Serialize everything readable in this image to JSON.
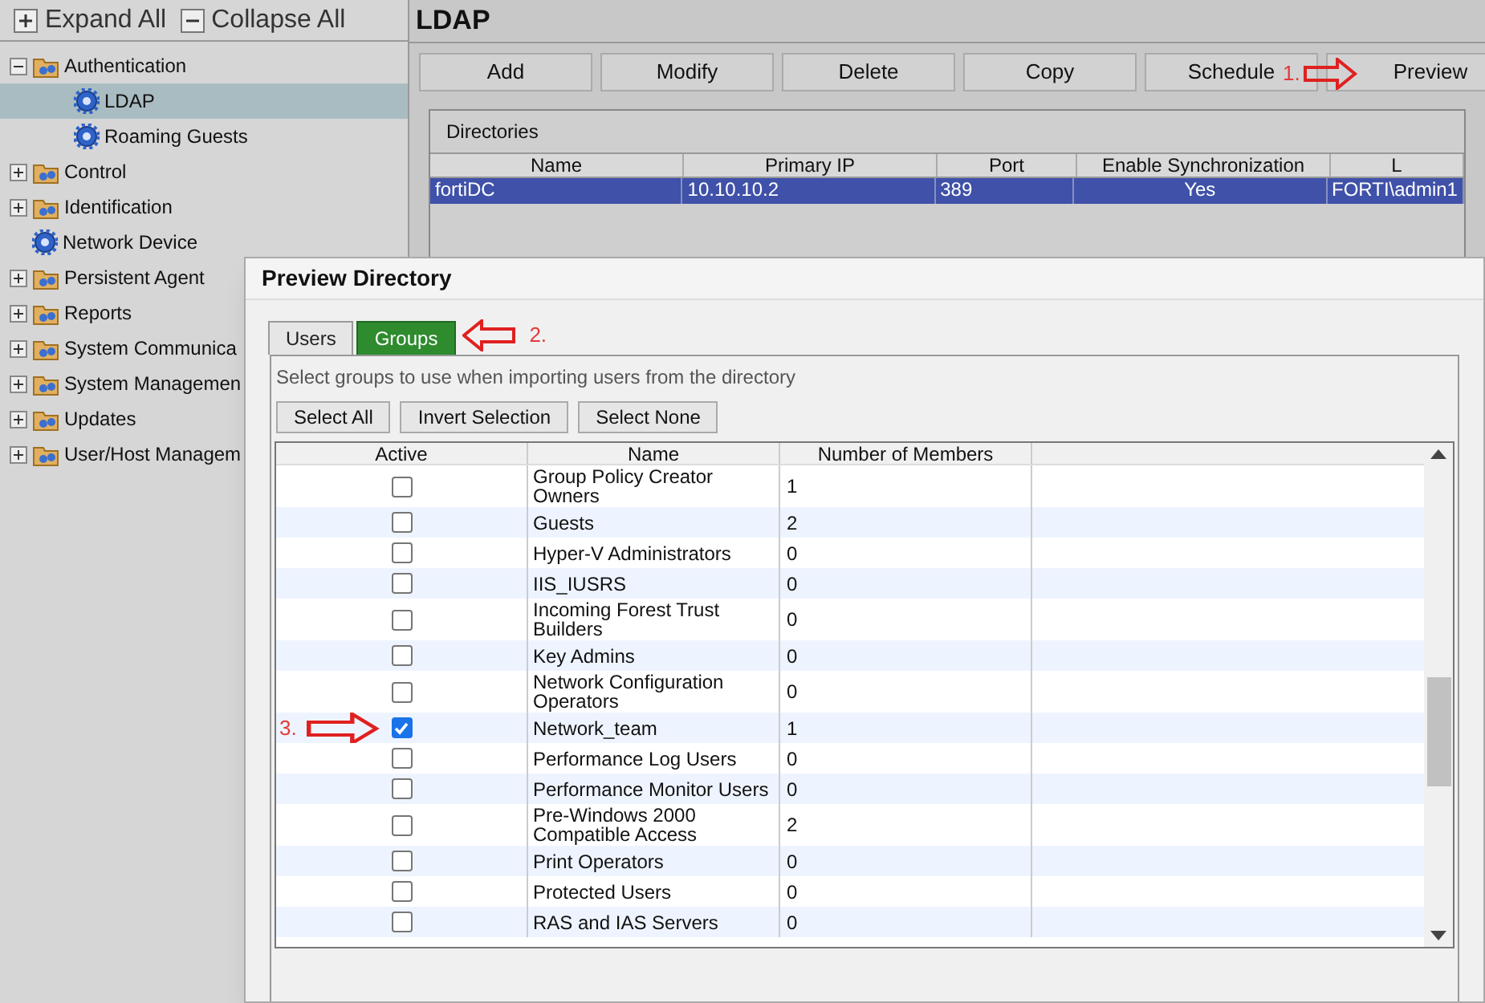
{
  "sidebar": {
    "toolbar": [
      {
        "label": "Expand All",
        "kind": "expand"
      },
      {
        "label": "Collapse All",
        "kind": "collapse"
      }
    ],
    "tree": [
      {
        "label": "Authentication",
        "kind": "folder",
        "expanded": true,
        "selected": false,
        "children": [
          {
            "label": "LDAP",
            "kind": "gear",
            "selected": true
          },
          {
            "label": "Roaming Guests",
            "kind": "gear",
            "selected": false
          }
        ]
      },
      {
        "label": "Control",
        "kind": "folder",
        "expanded": false,
        "selected": false
      },
      {
        "label": "Identification",
        "kind": "folder",
        "expanded": false,
        "selected": false
      },
      {
        "label": "Network Device",
        "kind": "gear",
        "selected": false
      },
      {
        "label": "Persistent Agent",
        "kind": "folder",
        "expanded": false,
        "selected": false
      },
      {
        "label": "Reports",
        "kind": "folder",
        "expanded": false,
        "selected": false
      },
      {
        "label": "System Communica",
        "kind": "folder",
        "expanded": false,
        "selected": false
      },
      {
        "label": "System Managemen",
        "kind": "folder",
        "expanded": false,
        "selected": false
      },
      {
        "label": "Updates",
        "kind": "folder",
        "expanded": false,
        "selected": false
      },
      {
        "label": "User/Host Managem",
        "kind": "folder",
        "expanded": false,
        "selected": false
      }
    ]
  },
  "main": {
    "title": "LDAP",
    "buttons": [
      "Add",
      "Modify",
      "Delete",
      "Copy",
      "Schedule",
      "Preview"
    ],
    "annotation": "1.",
    "directories": {
      "title": "Directories",
      "columns": [
        "Name",
        "Primary IP",
        "Port",
        "Enable Synchronization",
        "L"
      ],
      "rows": [
        {
          "cells": [
            "fortiDC",
            "10.10.10.2",
            "389",
            "Yes",
            "FORTI\\admin1"
          ],
          "selected": true
        }
      ]
    }
  },
  "dialog": {
    "title": "Preview Directory",
    "tabs": [
      {
        "label": "Users",
        "selected": false
      },
      {
        "label": "Groups",
        "selected": true
      }
    ],
    "tab_annotation": "2.",
    "hint": "Select groups to use when importing users from the directory",
    "buttons": [
      "Select All",
      "Invert Selection",
      "Select None"
    ],
    "columns": [
      "Active",
      "Name",
      "Number of Members"
    ],
    "row_annotation": "3.",
    "rows": [
      {
        "name": "Group Policy Creator Owners",
        "members": "1",
        "checked": false
      },
      {
        "name": "Guests",
        "members": "2",
        "checked": false
      },
      {
        "name": "Hyper-V Administrators",
        "members": "0",
        "checked": false
      },
      {
        "name": "IIS_IUSRS",
        "members": "0",
        "checked": false
      },
      {
        "name": "Incoming Forest Trust Builders",
        "members": "0",
        "checked": false
      },
      {
        "name": "Key Admins",
        "members": "0",
        "checked": false
      },
      {
        "name": "Network Configuration Operators",
        "members": "0",
        "checked": false
      },
      {
        "name": "Network_team",
        "members": "1",
        "checked": true,
        "annotated": true
      },
      {
        "name": "Performance Log Users",
        "members": "0",
        "checked": false
      },
      {
        "name": "Performance Monitor Users",
        "members": "0",
        "checked": false
      },
      {
        "name": "Pre-Windows 2000 Compatible Access",
        "members": "2",
        "checked": false
      },
      {
        "name": "Print Operators",
        "members": "0",
        "checked": false
      },
      {
        "name": "Protected Users",
        "members": "0",
        "checked": false
      },
      {
        "name": "RAS and IAS Servers",
        "members": "0",
        "checked": false
      }
    ]
  }
}
